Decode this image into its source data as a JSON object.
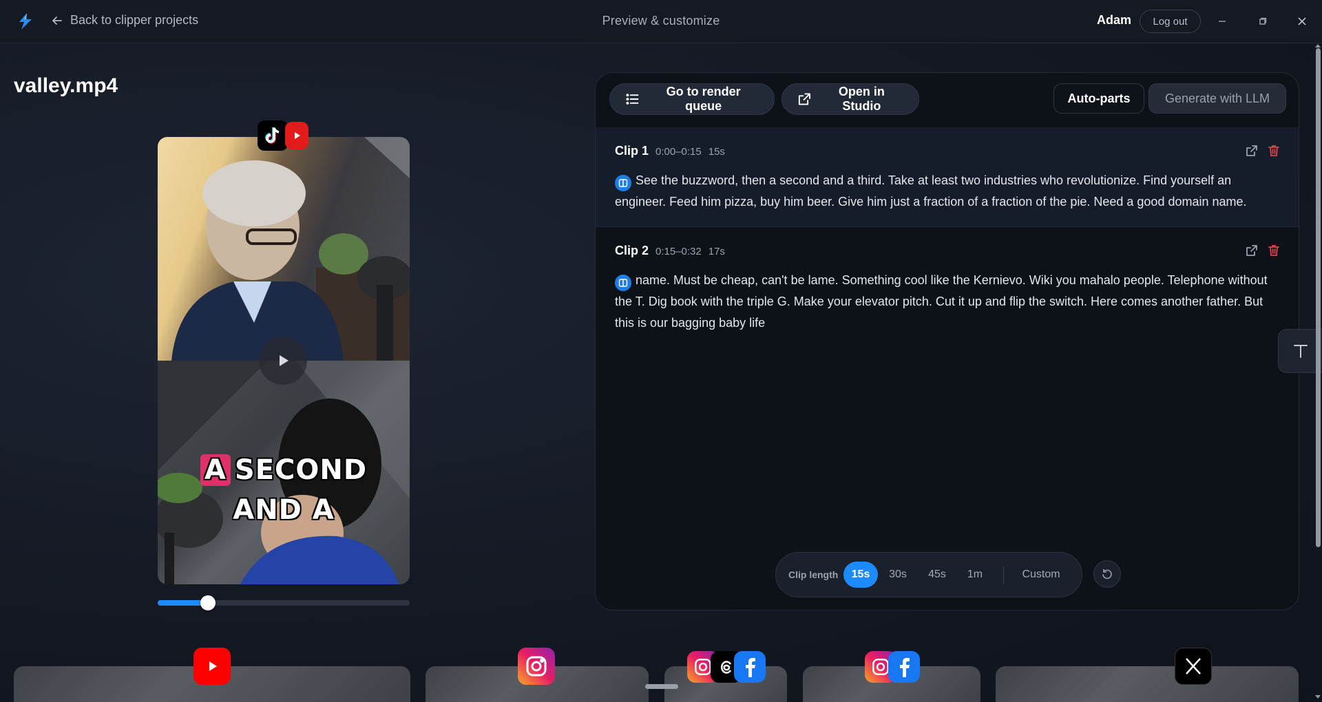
{
  "topbar": {
    "back_label": "Back to clipper projects",
    "title": "Preview & customize",
    "user": "Adam",
    "logout_label": "Log out"
  },
  "file": {
    "name": "valley.mp4"
  },
  "preview": {
    "caption_highlight": "A",
    "caption_line1": "SECOND",
    "caption_line2": "AND A",
    "playback_progress": 0.2,
    "platforms": [
      "tiktok-icon",
      "youtube-shorts-icon"
    ]
  },
  "panel": {
    "render_queue_label": "Go to render queue",
    "open_studio_label": "Open in Studio",
    "auto_parts_label": "Auto-parts",
    "generate_llm_label": "Generate with LLM",
    "clips": [
      {
        "name": "Clip 1",
        "range": "0:00–0:15",
        "duration": "15s",
        "text": "See the buzzword, then a second and a third. Take at least two industries who revolutionize. Find yourself an engineer. Feed him pizza, buy him beer. Give him just a fraction of a fraction of the pie. Need a good domain name."
      },
      {
        "name": "Clip 2",
        "range": "0:15–0:32",
        "duration": "17s",
        "text": "name. Must be cheap, can't be lame. Something cool like the Kernievo. Wiki you mahalo people. Telephone without the T. Dig book with the triple G. Make your elevator pitch. Cut it up and flip the switch. Here comes another father. But this is our bagging baby life"
      }
    ],
    "clip_length": {
      "label": "Clip length",
      "options": [
        "15s",
        "30s",
        "45s",
        "1m"
      ],
      "custom_label": "Custom",
      "selected": "15s"
    }
  },
  "bottom_strip": {
    "platforms": [
      "youtube-icon",
      "instagram-icon",
      "instagram-threads-facebook-icons",
      "instagram-facebook-icons",
      "x-icon"
    ]
  },
  "colors": {
    "accent": "#1d8bff",
    "danger": "#e0444a",
    "background": "#131822"
  }
}
